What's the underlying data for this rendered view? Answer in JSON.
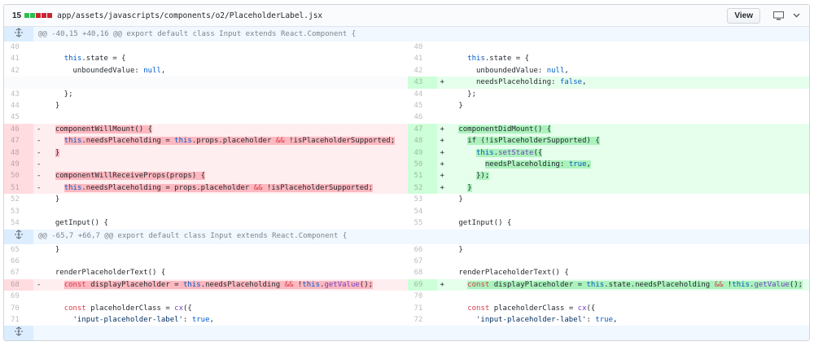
{
  "file": {
    "changes": "15",
    "diffstat_blocks": [
      "#2cbe4e",
      "#2cbe4e",
      "#cb2431",
      "#cb2431",
      "#cb2431"
    ],
    "path": "app/assets/javascripts/components/o2/PlaceholderLabel.jsx",
    "view_label": "View"
  },
  "hunks": [
    "@@ -40,15 +40,16 @@ export default class Input extends React.Component {",
    "@@ -65,7 +66,7 @@ export default class Input extends React.Component {"
  ],
  "rows": [
    {
      "t": "hunk",
      "idx": 0
    },
    {
      "t": "ctx",
      "l": "40",
      "r": "40",
      "code": ""
    },
    {
      "t": "ctx",
      "l": "41",
      "r": "41",
      "code": "    this.state = {"
    },
    {
      "t": "ctx",
      "l": "42",
      "r": "42",
      "code": "      unboundedValue: null,"
    },
    {
      "t": "add",
      "r": "43",
      "code": "      needsPlaceholding: false,"
    },
    {
      "t": "ctx",
      "l": "43",
      "r": "44",
      "code": "    };"
    },
    {
      "t": "ctx",
      "l": "44",
      "r": "45",
      "code": "  }"
    },
    {
      "t": "ctx",
      "l": "45",
      "r": "46",
      "code": ""
    },
    {
      "t": "chg",
      "l": "46",
      "lc": "  componentWillMount() {",
      "r": "47",
      "rc": "  componentDidMount() {"
    },
    {
      "t": "chg",
      "l": "47",
      "lc": "    this.needsPlaceholding = this.props.placeholder && !isPlaceholderSupported;",
      "r": "48",
      "rc": "    if (!isPlaceholderSupported) {"
    },
    {
      "t": "chg",
      "l": "48",
      "lc": "  }",
      "r": "49",
      "rc": "      this.setState({"
    },
    {
      "t": "chg",
      "l": "49",
      "lc": "",
      "r": "50",
      "rc": "        needsPlaceholding: true,"
    },
    {
      "t": "chg",
      "l": "50",
      "lc": "  componentWillReceiveProps(props) {",
      "r": "51",
      "rc": "      });"
    },
    {
      "t": "chg",
      "l": "51",
      "lc": "    this.needsPlaceholding = props.placeholder && !isPlaceholderSupported;",
      "r": "52",
      "rc": "    }"
    },
    {
      "t": "ctx",
      "l": "52",
      "r": "53",
      "code": "  }"
    },
    {
      "t": "ctx",
      "l": "53",
      "r": "54",
      "code": ""
    },
    {
      "t": "ctx",
      "l": "54",
      "r": "55",
      "code": "  getInput() {"
    },
    {
      "t": "hunk",
      "idx": 1
    },
    {
      "t": "ctx",
      "l": "65",
      "r": "66",
      "code": "  }"
    },
    {
      "t": "ctx",
      "l": "66",
      "r": "67",
      "code": ""
    },
    {
      "t": "ctx",
      "l": "67",
      "r": "68",
      "code": "  renderPlaceholderText() {"
    },
    {
      "t": "chg",
      "l": "68",
      "lc": "    const displayPlaceholder = this.needsPlaceholding && !this.getValue();",
      "r": "69",
      "rc": "    const displayPlaceholder = this.state.needsPlaceholding && !this.getValue();"
    },
    {
      "t": "ctx",
      "l": "69",
      "r": "70",
      "code": ""
    },
    {
      "t": "ctx",
      "l": "70",
      "r": "71",
      "code": "    const placeholderClass = cx({"
    },
    {
      "t": "ctx",
      "l": "71",
      "r": "72",
      "code": "      'input-placeholder-label': true,"
    },
    {
      "t": "end"
    }
  ],
  "icons": {
    "expand": "unfold-icon",
    "display": "display-icon",
    "chevron": "chevron-down-icon"
  },
  "colors": {
    "added": "#e6ffed",
    "deleted": "#ffeef0",
    "hunk": "#f1f8ff"
  }
}
